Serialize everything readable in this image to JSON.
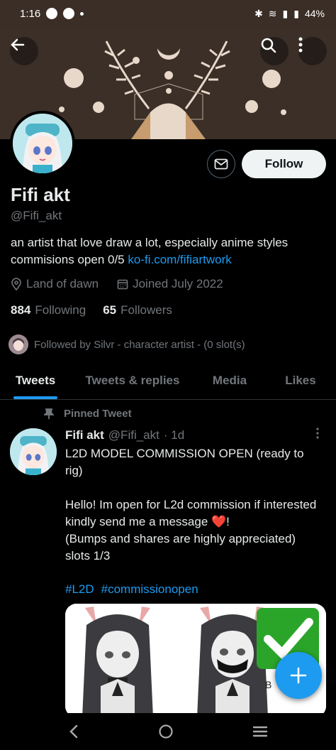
{
  "status": {
    "time": "1:16",
    "battery": "44%"
  },
  "icons": {
    "back": "back-arrow-icon",
    "search": "search-icon",
    "more": "more-vertical-icon",
    "message": "mail-icon",
    "location": "location-pin-icon",
    "calendar": "calendar-icon",
    "pin": "pin-icon",
    "compose": "plus-icon"
  },
  "profile": {
    "name": "Fifi akt",
    "handle": "@Fifi_akt",
    "bio_line1": "an artist that love draw a lot, especially anime styles",
    "bio_line2": "commisions open 0/5",
    "bio_link": "ko-fi.com/fifiartwork",
    "location": "Land of dawn",
    "joined": "Joined July 2022",
    "following_count": "884",
    "following_label": "Following",
    "followers_count": "65",
    "followers_label": "Followers",
    "followed_by": "Followed by Silvr - character artist - (0 slot(s)",
    "follow_button": "Follow"
  },
  "tabs": [
    {
      "label": "Tweets",
      "active": true
    },
    {
      "label": "Tweets & replies",
      "active": false
    },
    {
      "label": "Media",
      "active": false
    },
    {
      "label": "Likes",
      "active": false
    }
  ],
  "tweet": {
    "pinned_label": "Pinned Tweet",
    "author": "Fifi akt",
    "handle": "@Fifi_akt",
    "time": "· 1d",
    "text": "L2D MODEL COMMISSION OPEN (ready to rig)\n\nHello! Im open for L2d commission if interested kindly send me a message ❤️!\n(Bumps and shares are highly appreciated)\nslots 1/3",
    "hashtag1": "#L2D",
    "hashtag2": "#commissionopen",
    "media_overlay_text": "B"
  },
  "colors": {
    "accent": "#1d9bf0",
    "background": "#000000",
    "banner": "#3b2f28"
  }
}
